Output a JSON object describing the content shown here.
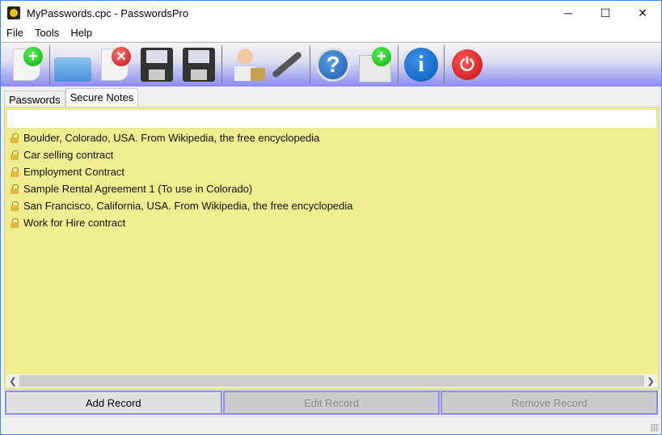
{
  "window": {
    "title": "MyPasswords.cpc - PasswordsPro",
    "minimize": "─",
    "maximize": "☐",
    "close": "✕"
  },
  "menu": [
    "File",
    "Tools",
    "Help"
  ],
  "toolbar": [
    {
      "icon": "new-record-icon"
    },
    {
      "icon": "print-icon"
    },
    {
      "icon": "delete-icon"
    },
    {
      "icon": "save-icon"
    },
    {
      "icon": "save-as-icon"
    },
    {
      "icon": "user-lock-icon"
    },
    {
      "icon": "tools-icon"
    },
    {
      "icon": "help-icon",
      "glyph": "?"
    },
    {
      "icon": "add-contact-icon"
    },
    {
      "icon": "info-icon",
      "glyph": "i"
    },
    {
      "icon": "power-icon",
      "glyph": "⏻"
    }
  ],
  "tabs": [
    {
      "label": "Passwords",
      "active": false
    },
    {
      "label": "Secure Notes",
      "active": true
    }
  ],
  "search": {
    "value": ""
  },
  "notes": [
    "Boulder, Colorado, USA. From Wikipedia, the free encyclopedia",
    "Car selling contract",
    "Employment Contract",
    "Sample Rental Agreement 1 (To use in Colorado)",
    "San Francisco, California, USA. From Wikipedia, the free encyclopedia",
    "Work for Hire contract"
  ],
  "buttons": {
    "add": "Add Record",
    "edit": "Edit Record",
    "remove": "Remove Record"
  },
  "colors": {
    "list_bg": "#f0ec90",
    "toolbar_accent": "#8a8af4",
    "window_border": "#3a8ee6"
  }
}
